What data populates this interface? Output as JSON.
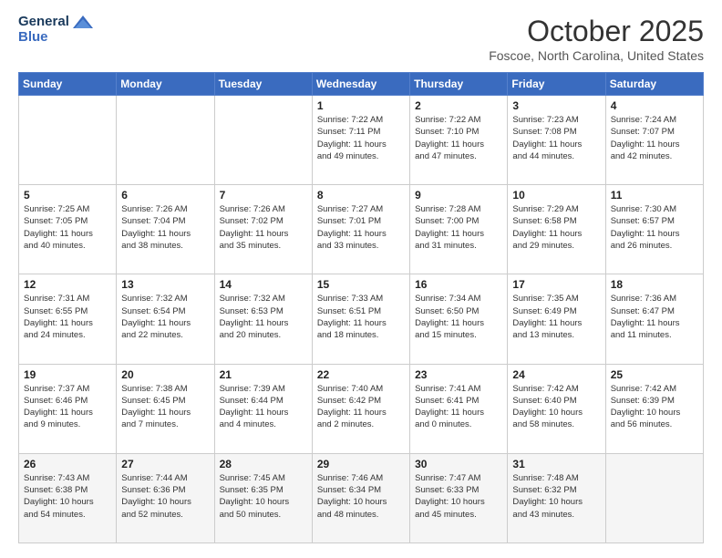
{
  "logo": {
    "line1": "General",
    "line2": "Blue"
  },
  "header": {
    "month": "October 2025",
    "location": "Foscoe, North Carolina, United States"
  },
  "weekdays": [
    "Sunday",
    "Monday",
    "Tuesday",
    "Wednesday",
    "Thursday",
    "Friday",
    "Saturday"
  ],
  "weeks": [
    [
      {
        "day": "",
        "info": ""
      },
      {
        "day": "",
        "info": ""
      },
      {
        "day": "",
        "info": ""
      },
      {
        "day": "1",
        "info": "Sunrise: 7:22 AM\nSunset: 7:11 PM\nDaylight: 11 hours\nand 49 minutes."
      },
      {
        "day": "2",
        "info": "Sunrise: 7:22 AM\nSunset: 7:10 PM\nDaylight: 11 hours\nand 47 minutes."
      },
      {
        "day": "3",
        "info": "Sunrise: 7:23 AM\nSunset: 7:08 PM\nDaylight: 11 hours\nand 44 minutes."
      },
      {
        "day": "4",
        "info": "Sunrise: 7:24 AM\nSunset: 7:07 PM\nDaylight: 11 hours\nand 42 minutes."
      }
    ],
    [
      {
        "day": "5",
        "info": "Sunrise: 7:25 AM\nSunset: 7:05 PM\nDaylight: 11 hours\nand 40 minutes."
      },
      {
        "day": "6",
        "info": "Sunrise: 7:26 AM\nSunset: 7:04 PM\nDaylight: 11 hours\nand 38 minutes."
      },
      {
        "day": "7",
        "info": "Sunrise: 7:26 AM\nSunset: 7:02 PM\nDaylight: 11 hours\nand 35 minutes."
      },
      {
        "day": "8",
        "info": "Sunrise: 7:27 AM\nSunset: 7:01 PM\nDaylight: 11 hours\nand 33 minutes."
      },
      {
        "day": "9",
        "info": "Sunrise: 7:28 AM\nSunset: 7:00 PM\nDaylight: 11 hours\nand 31 minutes."
      },
      {
        "day": "10",
        "info": "Sunrise: 7:29 AM\nSunset: 6:58 PM\nDaylight: 11 hours\nand 29 minutes."
      },
      {
        "day": "11",
        "info": "Sunrise: 7:30 AM\nSunset: 6:57 PM\nDaylight: 11 hours\nand 26 minutes."
      }
    ],
    [
      {
        "day": "12",
        "info": "Sunrise: 7:31 AM\nSunset: 6:55 PM\nDaylight: 11 hours\nand 24 minutes."
      },
      {
        "day": "13",
        "info": "Sunrise: 7:32 AM\nSunset: 6:54 PM\nDaylight: 11 hours\nand 22 minutes."
      },
      {
        "day": "14",
        "info": "Sunrise: 7:32 AM\nSunset: 6:53 PM\nDaylight: 11 hours\nand 20 minutes."
      },
      {
        "day": "15",
        "info": "Sunrise: 7:33 AM\nSunset: 6:51 PM\nDaylight: 11 hours\nand 18 minutes."
      },
      {
        "day": "16",
        "info": "Sunrise: 7:34 AM\nSunset: 6:50 PM\nDaylight: 11 hours\nand 15 minutes."
      },
      {
        "day": "17",
        "info": "Sunrise: 7:35 AM\nSunset: 6:49 PM\nDaylight: 11 hours\nand 13 minutes."
      },
      {
        "day": "18",
        "info": "Sunrise: 7:36 AM\nSunset: 6:47 PM\nDaylight: 11 hours\nand 11 minutes."
      }
    ],
    [
      {
        "day": "19",
        "info": "Sunrise: 7:37 AM\nSunset: 6:46 PM\nDaylight: 11 hours\nand 9 minutes."
      },
      {
        "day": "20",
        "info": "Sunrise: 7:38 AM\nSunset: 6:45 PM\nDaylight: 11 hours\nand 7 minutes."
      },
      {
        "day": "21",
        "info": "Sunrise: 7:39 AM\nSunset: 6:44 PM\nDaylight: 11 hours\nand 4 minutes."
      },
      {
        "day": "22",
        "info": "Sunrise: 7:40 AM\nSunset: 6:42 PM\nDaylight: 11 hours\nand 2 minutes."
      },
      {
        "day": "23",
        "info": "Sunrise: 7:41 AM\nSunset: 6:41 PM\nDaylight: 11 hours\nand 0 minutes."
      },
      {
        "day": "24",
        "info": "Sunrise: 7:42 AM\nSunset: 6:40 PM\nDaylight: 10 hours\nand 58 minutes."
      },
      {
        "day": "25",
        "info": "Sunrise: 7:42 AM\nSunset: 6:39 PM\nDaylight: 10 hours\nand 56 minutes."
      }
    ],
    [
      {
        "day": "26",
        "info": "Sunrise: 7:43 AM\nSunset: 6:38 PM\nDaylight: 10 hours\nand 54 minutes."
      },
      {
        "day": "27",
        "info": "Sunrise: 7:44 AM\nSunset: 6:36 PM\nDaylight: 10 hours\nand 52 minutes."
      },
      {
        "day": "28",
        "info": "Sunrise: 7:45 AM\nSunset: 6:35 PM\nDaylight: 10 hours\nand 50 minutes."
      },
      {
        "day": "29",
        "info": "Sunrise: 7:46 AM\nSunset: 6:34 PM\nDaylight: 10 hours\nand 48 minutes."
      },
      {
        "day": "30",
        "info": "Sunrise: 7:47 AM\nSunset: 6:33 PM\nDaylight: 10 hours\nand 45 minutes."
      },
      {
        "day": "31",
        "info": "Sunrise: 7:48 AM\nSunset: 6:32 PM\nDaylight: 10 hours\nand 43 minutes."
      },
      {
        "day": "",
        "info": ""
      }
    ]
  ]
}
